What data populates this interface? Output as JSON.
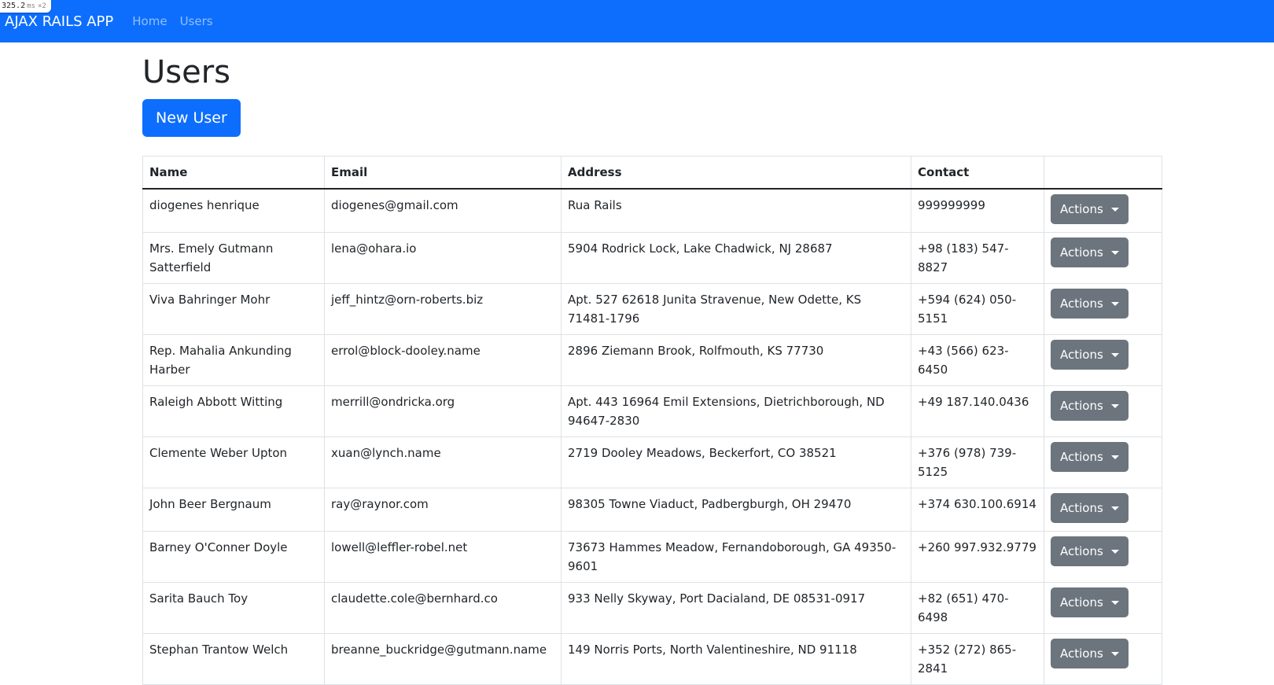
{
  "perf": {
    "value": "325.2",
    "unit": "ms",
    "multiplier": "×2"
  },
  "navbar": {
    "brand": "AJAX RAILS APP",
    "links": [
      "Home",
      "Users"
    ]
  },
  "page": {
    "title": "Users",
    "new_button": "New User"
  },
  "table": {
    "headers": [
      "Name",
      "Email",
      "Address",
      "Contact",
      ""
    ],
    "action_label": "Actions",
    "rows": [
      {
        "name": "diogenes henrique",
        "email": "diogenes@gmail.com",
        "address": "Rua Rails",
        "contact": "999999999"
      },
      {
        "name": "Mrs. Emely Gutmann Satterfield",
        "email": "lena@ohara.io",
        "address": "5904 Rodrick Lock, Lake Chadwick, NJ 28687",
        "contact": "+98 (183) 547-8827"
      },
      {
        "name": "Viva Bahringer Mohr",
        "email": "jeff_hintz@orn-roberts.biz",
        "address": "Apt. 527 62618 Junita Stravenue, New Odette, KS 71481-1796",
        "contact": "+594 (624) 050-5151"
      },
      {
        "name": "Rep. Mahalia Ankunding Harber",
        "email": "errol@block-dooley.name",
        "address": "2896 Ziemann Brook, Rolfmouth, KS 77730",
        "contact": "+43 (566) 623-6450"
      },
      {
        "name": "Raleigh Abbott Witting",
        "email": "merrill@ondricka.org",
        "address": "Apt. 443 16964 Emil Extensions, Dietrichborough, ND 94647-2830",
        "contact": "+49 187.140.0436"
      },
      {
        "name": "Clemente Weber Upton",
        "email": "xuan@lynch.name",
        "address": "2719 Dooley Meadows, Beckerfort, CO 38521",
        "contact": "+376 (978) 739-5125"
      },
      {
        "name": "John Beer Bergnaum",
        "email": "ray@raynor.com",
        "address": "98305 Towne Viaduct, Padbergburgh, OH 29470",
        "contact": "+374 630.100.6914"
      },
      {
        "name": "Barney O'Conner Doyle",
        "email": "lowell@leffler-robel.net",
        "address": "73673 Hammes Meadow, Fernandoborough, GA 49350-9601",
        "contact": "+260 997.932.9779"
      },
      {
        "name": "Sarita Bauch Toy",
        "email": "claudette.cole@bernhard.co",
        "address": "933 Nelly Skyway, Port Dacialand, DE 08531-0917",
        "contact": "+82 (651) 470-6498"
      },
      {
        "name": "Stephan Trantow Welch",
        "email": "breanne_buckridge@gutmann.name",
        "address": "149 Norris Ports, North Valentineshire, ND 91118",
        "contact": "+352 (272) 865-2841"
      }
    ]
  },
  "colors": {
    "navbar": "#0d6efd",
    "primary_button": "#0d6efd",
    "secondary_button": "#6c757d"
  }
}
